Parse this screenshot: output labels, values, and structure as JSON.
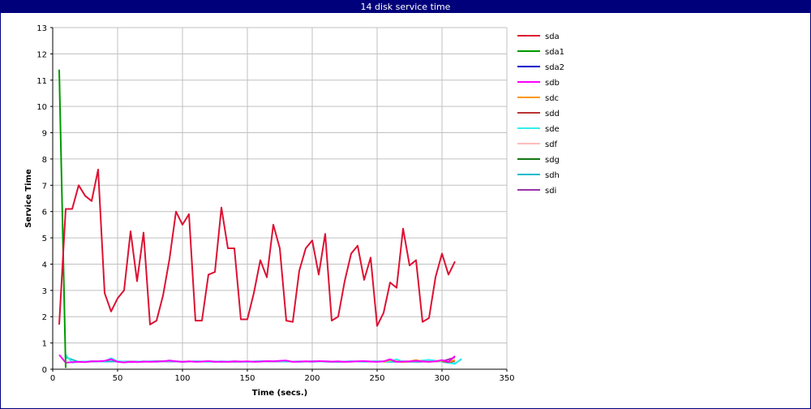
{
  "chart_data": {
    "type": "line",
    "title": "14 disk service time",
    "xlabel": "Time (secs.)",
    "ylabel": "Service Time",
    "xlim": [
      0,
      350
    ],
    "ylim": [
      0,
      13
    ],
    "x_ticks": [
      0,
      50,
      100,
      150,
      200,
      250,
      300,
      350
    ],
    "y_ticks": [
      0,
      1,
      2,
      3,
      4,
      5,
      6,
      7,
      8,
      9,
      10,
      11,
      12,
      13
    ],
    "grid": true,
    "legend_position": "right",
    "series": [
      {
        "name": "sda",
        "color": "#dd1133",
        "x": [
          5,
          10,
          15,
          20,
          25,
          30,
          35,
          40,
          45,
          50,
          55,
          60,
          65,
          70,
          75,
          80,
          85,
          90,
          95,
          100,
          105,
          110,
          115,
          120,
          125,
          130,
          135,
          140,
          145,
          150,
          155,
          160,
          165,
          170,
          175,
          180,
          185,
          190,
          195,
          200,
          205,
          210,
          215,
          220,
          225,
          230,
          235,
          240,
          245,
          250,
          255,
          260,
          265,
          270,
          275,
          280,
          285,
          290,
          295,
          300,
          305,
          310
        ],
        "y": [
          1.7,
          6.1,
          6.1,
          7.0,
          6.6,
          6.4,
          7.6,
          2.9,
          2.2,
          2.7,
          3.0,
          5.25,
          3.35,
          5.2,
          1.7,
          1.85,
          2.8,
          4.2,
          6.0,
          5.5,
          5.9,
          1.85,
          1.85,
          3.6,
          3.7,
          6.15,
          4.6,
          4.6,
          1.9,
          1.9,
          2.9,
          4.15,
          3.5,
          5.5,
          4.6,
          1.85,
          1.8,
          3.75,
          4.6,
          4.9,
          3.6,
          5.15,
          1.85,
          2.0,
          3.35,
          4.4,
          4.7,
          3.4,
          4.25,
          1.65,
          2.15,
          3.3,
          3.1,
          5.35,
          3.95,
          4.15,
          1.8,
          1.95,
          3.5,
          4.4,
          3.6,
          4.1
        ]
      },
      {
        "name": "sda1",
        "color": "#009900",
        "x": [
          5,
          10
        ],
        "y": [
          11.4,
          0.05
        ]
      },
      {
        "name": "sda2",
        "color": "#0000cc",
        "x": [],
        "y": []
      },
      {
        "name": "sdb",
        "color": "#ff00ff",
        "x": [
          5,
          10,
          15,
          20,
          25,
          30,
          35,
          40,
          45,
          50,
          55,
          60,
          65,
          70,
          75,
          80,
          85,
          90,
          95,
          100,
          105,
          110,
          115,
          120,
          125,
          130,
          135,
          140,
          145,
          150,
          155,
          160,
          165,
          170,
          175,
          180,
          185,
          190,
          195,
          200,
          205,
          210,
          215,
          220,
          225,
          230,
          235,
          240,
          245,
          250,
          255,
          260,
          265,
          270,
          275,
          280,
          285,
          290,
          295,
          300,
          305,
          310
        ],
        "y": [
          0.55,
          0.25,
          0.27,
          0.28,
          0.27,
          0.3,
          0.3,
          0.32,
          0.38,
          0.28,
          0.26,
          0.28,
          0.27,
          0.29,
          0.28,
          0.29,
          0.3,
          0.33,
          0.3,
          0.28,
          0.3,
          0.28,
          0.29,
          0.31,
          0.28,
          0.29,
          0.28,
          0.3,
          0.29,
          0.3,
          0.28,
          0.29,
          0.31,
          0.3,
          0.32,
          0.33,
          0.28,
          0.29,
          0.3,
          0.29,
          0.31,
          0.3,
          0.29,
          0.3,
          0.28,
          0.29,
          0.3,
          0.31,
          0.29,
          0.28,
          0.3,
          0.38,
          0.28,
          0.29,
          0.3,
          0.32,
          0.3,
          0.28,
          0.3,
          0.35,
          0.28,
          0.5
        ]
      },
      {
        "name": "sdc",
        "color": "#ff9900",
        "x": [
          255,
          260,
          265,
          270,
          275,
          280,
          285,
          290,
          295,
          300,
          305,
          310
        ],
        "y": [
          0.28,
          0.35,
          0.3,
          0.27,
          0.3,
          0.35,
          0.3,
          0.28,
          0.3,
          0.33,
          0.29,
          0.35
        ]
      },
      {
        "name": "sdd",
        "color": "#bb3333",
        "x": [
          300,
          305,
          310
        ],
        "y": [
          0.3,
          0.27,
          0.32
        ]
      },
      {
        "name": "sde",
        "color": "#33eeee",
        "x": [
          10,
          15,
          20,
          30,
          40,
          45,
          50,
          60,
          70,
          80,
          90,
          100,
          110,
          120,
          130,
          140,
          150,
          160,
          170,
          180,
          190,
          200,
          210,
          220,
          230,
          240,
          250,
          260,
          265,
          270,
          280,
          290,
          300,
          310,
          315
        ],
        "y": [
          0.55,
          0.25,
          0.28,
          0.3,
          0.3,
          0.42,
          0.3,
          0.27,
          0.3,
          0.28,
          0.32,
          0.29,
          0.3,
          0.28,
          0.3,
          0.29,
          0.28,
          0.3,
          0.31,
          0.29,
          0.3,
          0.28,
          0.3,
          0.29,
          0.3,
          0.28,
          0.3,
          0.3,
          0.38,
          0.28,
          0.3,
          0.36,
          0.28,
          0.2,
          0.4
        ]
      },
      {
        "name": "sdf",
        "color": "#ffbbbb",
        "x": [],
        "y": []
      },
      {
        "name": "sdg",
        "color": "#117711",
        "x": [],
        "y": []
      },
      {
        "name": "sdh",
        "color": "#11bbcc",
        "x": [
          10,
          20,
          30,
          40,
          50,
          60,
          70,
          80,
          90,
          100,
          110,
          120,
          130,
          140,
          150,
          160,
          170,
          180,
          190,
          200,
          210,
          220,
          230,
          240,
          250,
          260,
          270,
          280,
          290,
          300,
          310,
          315
        ],
        "y": [
          0.45,
          0.28,
          0.3,
          0.29,
          0.3,
          0.28,
          0.29,
          0.3,
          0.31,
          0.28,
          0.3,
          0.29,
          0.28,
          0.3,
          0.29,
          0.3,
          0.31,
          0.3,
          0.28,
          0.3,
          0.29,
          0.28,
          0.3,
          0.29,
          0.3,
          0.28,
          0.3,
          0.29,
          0.3,
          0.32,
          0.22,
          0.38
        ]
      },
      {
        "name": "sdi",
        "color": "#9933aa",
        "x": [
          20,
          40,
          60,
          80,
          100,
          120,
          140,
          160,
          180,
          200,
          220,
          240,
          260,
          280,
          300,
          310
        ],
        "y": [
          0.28,
          0.3,
          0.29,
          0.3,
          0.29,
          0.3,
          0.28,
          0.3,
          0.29,
          0.3,
          0.28,
          0.3,
          0.29,
          0.28,
          0.3,
          0.45
        ]
      }
    ]
  }
}
